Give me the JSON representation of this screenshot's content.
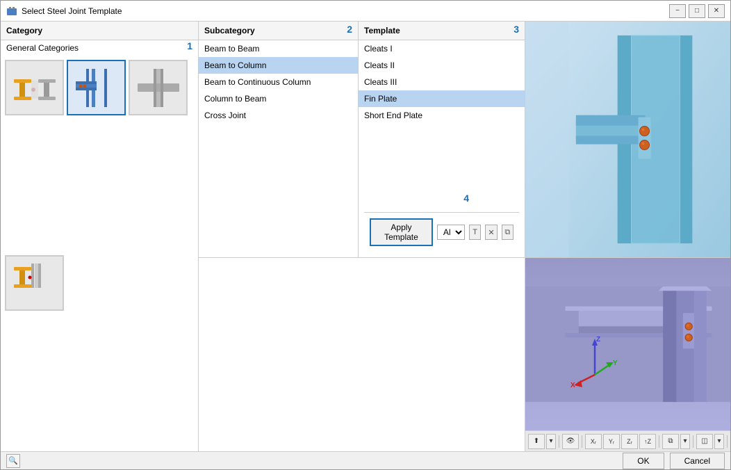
{
  "window": {
    "title": "Select Steel Joint Template",
    "minimize_label": "−",
    "maximize_label": "□",
    "close_label": "✕"
  },
  "category": {
    "header": "Category",
    "label": "General Categories",
    "step_badge": "1"
  },
  "subcategory": {
    "header": "Subcategory",
    "step_badge": "2",
    "items": [
      {
        "label": "Beam to Beam",
        "selected": false
      },
      {
        "label": "Beam to Column",
        "selected": true
      },
      {
        "label": "Beam to Continuous Column",
        "selected": false
      },
      {
        "label": "Column to Beam",
        "selected": false
      },
      {
        "label": "Cross Joint",
        "selected": false
      }
    ]
  },
  "template": {
    "header": "Template",
    "step_badge": "3",
    "items": [
      {
        "label": "Cleats I",
        "selected": false
      },
      {
        "label": "Cleats II",
        "selected": false
      },
      {
        "label": "Cleats III",
        "selected": false
      },
      {
        "label": "Fin Plate",
        "selected": true
      },
      {
        "label": "Short End Plate",
        "selected": false
      }
    ]
  },
  "apply_area": {
    "step_badge": "4",
    "apply_label": "Apply Template",
    "filter_option": "All"
  },
  "toolbar": {
    "ok_label": "OK",
    "cancel_label": "Cancel"
  }
}
